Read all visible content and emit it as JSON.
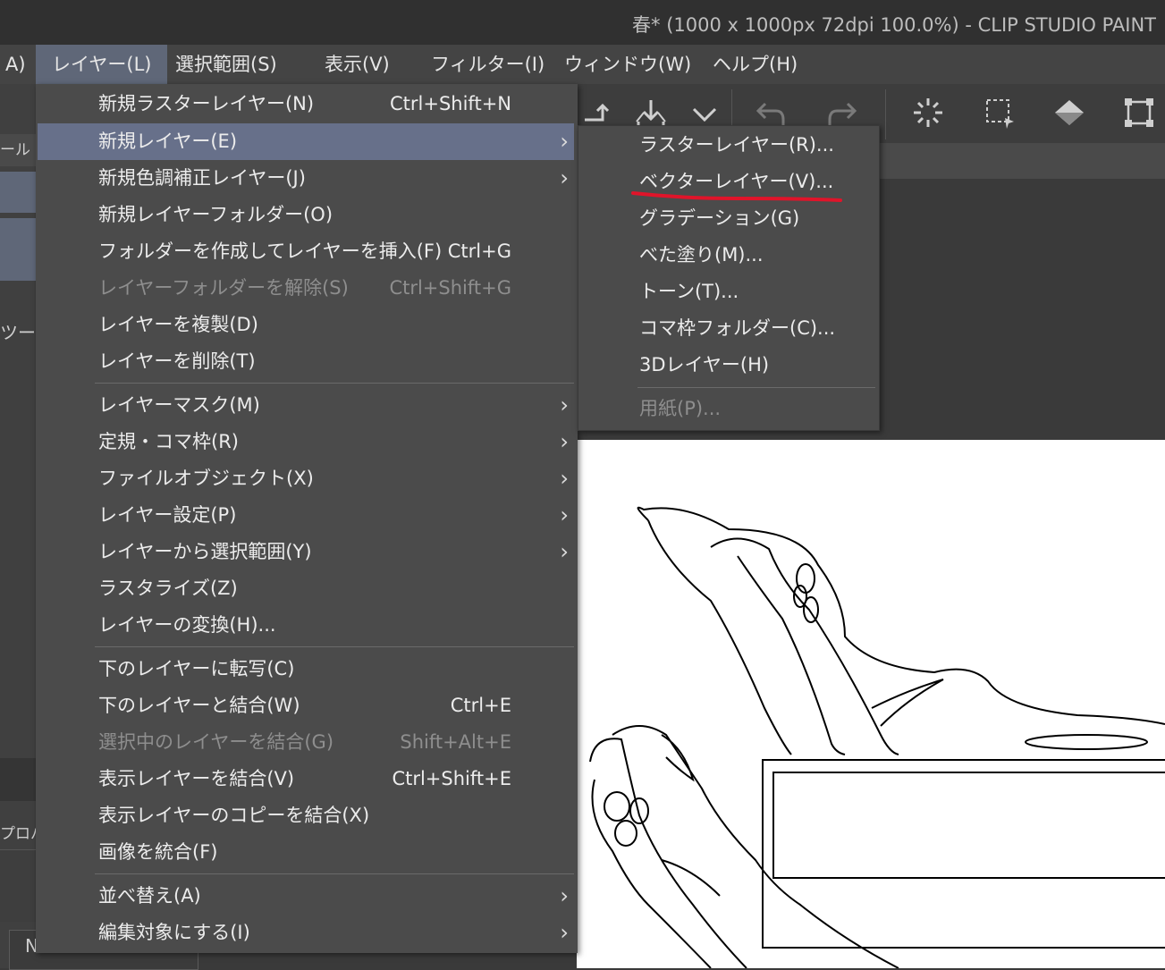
{
  "window": {
    "title": "春* (1000 x 1000px 72dpi 100.0%)  - CLIP STUDIO PAINT"
  },
  "menubar": {
    "items": [
      {
        "label": "A)",
        "active": false
      },
      {
        "label": "レイヤー(L)",
        "active": true
      },
      {
        "label": "選択範囲(S)",
        "active": false
      },
      {
        "label": "表示(V)",
        "active": false
      },
      {
        "label": "フィルター(I)",
        "active": false
      },
      {
        "label": "ウィンドウ(W)",
        "active": false
      },
      {
        "label": "ヘルプ(H)",
        "active": false
      }
    ]
  },
  "layer_menu": {
    "items": [
      {
        "label": "新規ラスターレイヤー(N)",
        "shortcut": "Ctrl+Shift+N",
        "submenu": false,
        "disabled": false,
        "highlighted": false
      },
      {
        "label": "新規レイヤー(E)",
        "shortcut": "",
        "submenu": true,
        "disabled": false,
        "highlighted": true
      },
      {
        "label": "新規色調補正レイヤー(J)",
        "shortcut": "",
        "submenu": true,
        "disabled": false,
        "highlighted": false
      },
      {
        "label": "新規レイヤーフォルダー(O)",
        "shortcut": "",
        "submenu": false,
        "disabled": false,
        "highlighted": false
      },
      {
        "label": "フォルダーを作成してレイヤーを挿入(F)",
        "shortcut": "Ctrl+G",
        "submenu": false,
        "disabled": false,
        "highlighted": false
      },
      {
        "label": "レイヤーフォルダーを解除(S)",
        "shortcut": "Ctrl+Shift+G",
        "submenu": false,
        "disabled": true,
        "highlighted": false
      },
      {
        "label": "レイヤーを複製(D)",
        "shortcut": "",
        "submenu": false,
        "disabled": false,
        "highlighted": false
      },
      {
        "label": "レイヤーを削除(T)",
        "shortcut": "",
        "submenu": false,
        "disabled": false,
        "highlighted": false
      },
      {
        "label": "レイヤーマスク(M)",
        "shortcut": "",
        "submenu": true,
        "disabled": false,
        "highlighted": false
      },
      {
        "label": "定規・コマ枠(R)",
        "shortcut": "",
        "submenu": true,
        "disabled": false,
        "highlighted": false
      },
      {
        "label": "ファイルオブジェクト(X)",
        "shortcut": "",
        "submenu": true,
        "disabled": false,
        "highlighted": false
      },
      {
        "label": "レイヤー設定(P)",
        "shortcut": "",
        "submenu": true,
        "disabled": false,
        "highlighted": false
      },
      {
        "label": "レイヤーから選択範囲(Y)",
        "shortcut": "",
        "submenu": true,
        "disabled": false,
        "highlighted": false
      },
      {
        "label": "ラスタライズ(Z)",
        "shortcut": "",
        "submenu": false,
        "disabled": false,
        "highlighted": false
      },
      {
        "label": "レイヤーの変換(H)...",
        "shortcut": "",
        "submenu": false,
        "disabled": false,
        "highlighted": false
      },
      {
        "label": "下のレイヤーに転写(C)",
        "shortcut": "",
        "submenu": false,
        "disabled": false,
        "highlighted": false
      },
      {
        "label": "下のレイヤーと結合(W)",
        "shortcut": "Ctrl+E",
        "submenu": false,
        "disabled": false,
        "highlighted": false
      },
      {
        "label": "選択中のレイヤーを結合(G)",
        "shortcut": "Shift+Alt+E",
        "submenu": false,
        "disabled": true,
        "highlighted": false
      },
      {
        "label": "表示レイヤーを結合(V)",
        "shortcut": "Ctrl+Shift+E",
        "submenu": false,
        "disabled": false,
        "highlighted": false
      },
      {
        "label": "表示レイヤーのコピーを結合(X)",
        "shortcut": "",
        "submenu": false,
        "disabled": false,
        "highlighted": false
      },
      {
        "label": "画像を統合(F)",
        "shortcut": "",
        "submenu": false,
        "disabled": false,
        "highlighted": false
      },
      {
        "label": "並べ替え(A)",
        "shortcut": "",
        "submenu": true,
        "disabled": false,
        "highlighted": false
      },
      {
        "label": "編集対象にする(I)",
        "shortcut": "",
        "submenu": true,
        "disabled": false,
        "highlighted": false
      }
    ]
  },
  "new_layer_submenu": {
    "items": [
      {
        "label": "ラスターレイヤー(R)...",
        "disabled": false
      },
      {
        "label": "ベクターレイヤー(V)...",
        "disabled": false,
        "annotated": true
      },
      {
        "label": "グラデーション(G)",
        "disabled": false
      },
      {
        "label": "べた塗り(M)...",
        "disabled": false
      },
      {
        "label": "トーン(T)...",
        "disabled": false
      },
      {
        "label": "コマ枠フォルダー(C)...",
        "disabled": false
      },
      {
        "label": "3Dレイヤー(H)",
        "disabled": false
      },
      {
        "label": "用紙(P)...",
        "disabled": true
      }
    ]
  },
  "left_panel": {
    "tab_fragment": "ール",
    "tool_fragment": "ツー",
    "property_fragment": "プロパ",
    "bottom_fragment": "N"
  },
  "toolbar": {
    "icons": [
      "rotate-icon",
      "import-icon",
      "chevron-down-icon",
      "undo-icon",
      "redo-icon",
      "selection-launcher-icon",
      "select-all-icon",
      "fill-icon",
      "transform-icon"
    ]
  },
  "colors": {
    "menu_bg": "#4b4b4b",
    "highlight": "#67708a",
    "annotation_red": "#e0142a"
  }
}
